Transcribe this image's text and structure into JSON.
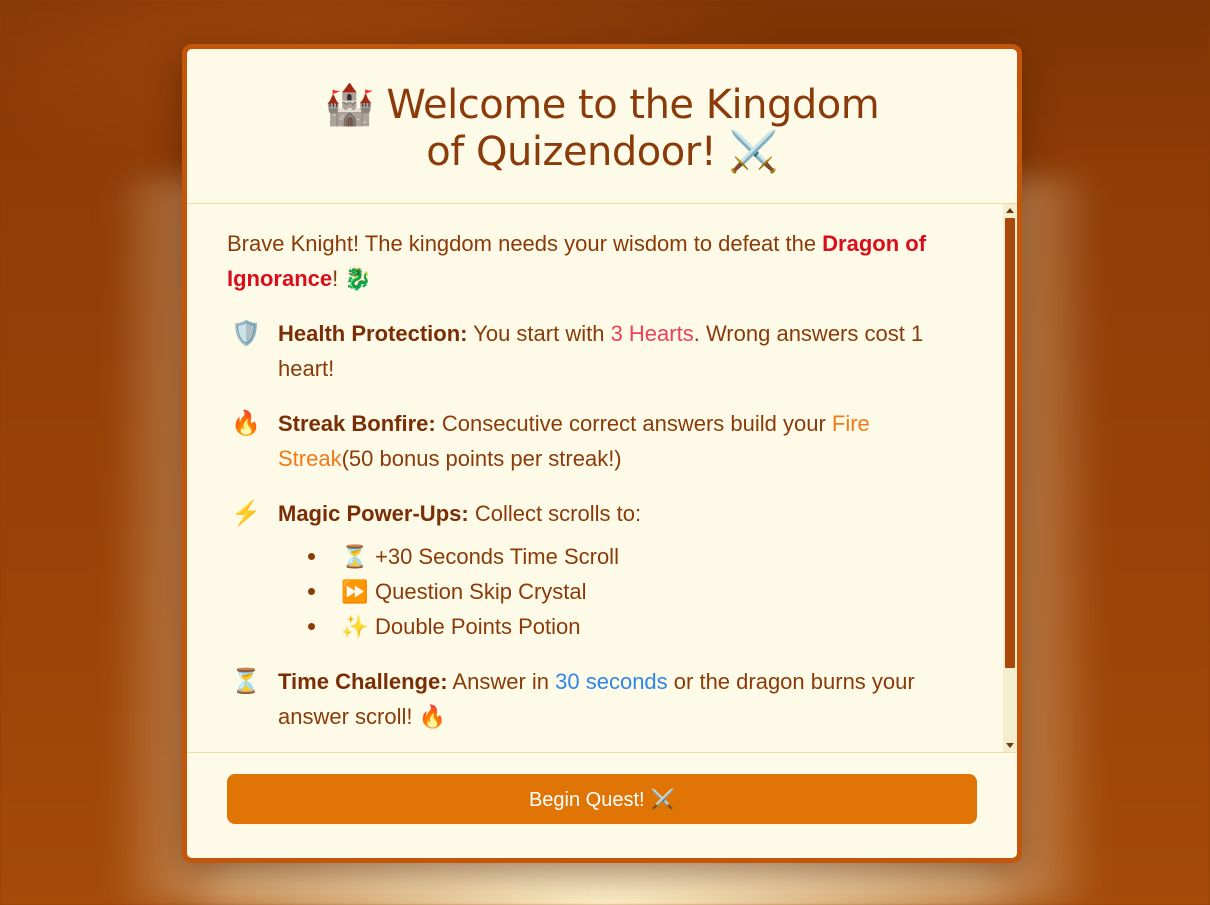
{
  "modal": {
    "title": "🏰 Welcome to the Kingdom of Quizendoor! ⚔️",
    "intro": {
      "text_before": "Brave Knight! The kingdom needs your wisdom to defeat the ",
      "highlight": "Dragon of Ignorance",
      "text_after": "! 🐉"
    },
    "rules": [
      {
        "icon": "🛡️",
        "icon_name": "shield-icon",
        "title": "Health Protection:",
        "text_before": " You start with ",
        "highlight": "3 Hearts",
        "text_after": ". Wrong answers cost 1 heart!"
      },
      {
        "icon": "🔥",
        "icon_name": "fire-icon",
        "title": "Streak Bonfire:",
        "text_before": " Consecutive correct answers build your ",
        "highlight": "Fire Streak",
        "text_after": "(50 bonus points per streak!)"
      },
      {
        "icon": "⚡",
        "icon_name": "lightning-icon",
        "title": "Magic Power-Ups:",
        "text_before": " Collect scrolls to:",
        "powerups": [
          {
            "icon": "⏳",
            "icon_name": "hourglass-icon",
            "label": "+30 Seconds Time Scroll"
          },
          {
            "icon": "⏩",
            "icon_name": "fast-forward-icon",
            "label": "Question Skip Crystal"
          },
          {
            "icon": "✨",
            "icon_name": "sparkles-icon",
            "label": "Double Points Potion"
          }
        ]
      },
      {
        "icon": "⏳",
        "icon_name": "hourglass-icon",
        "title": "Time Challenge:",
        "text_before": " Answer in ",
        "highlight": "30 seconds",
        "text_after": " or the dragon burns your answer scroll! 🔥"
      }
    ],
    "button_label": "Begin Quest! ⚔️"
  },
  "colors": {
    "accent": "#e07506",
    "border": "#c2570b",
    "text": "#8a3b09",
    "danger": "#d90e1b",
    "hearts": "#ec4156",
    "fire": "#f07a16",
    "time": "#2f86e6",
    "modal_bg": "#fefae8"
  }
}
